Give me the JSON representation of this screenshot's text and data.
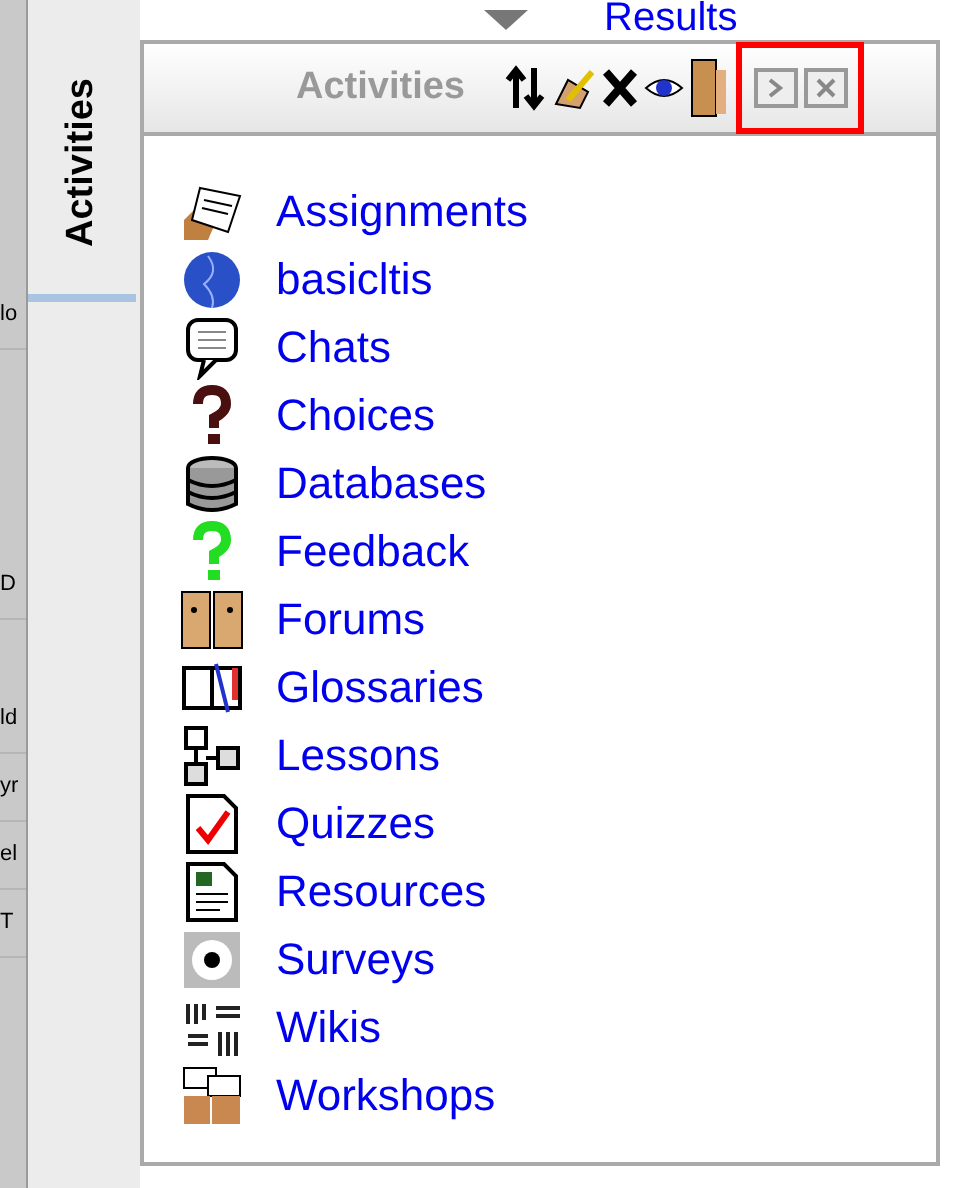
{
  "left_column_fragments": [
    "lo",
    "D",
    "ld",
    "yr",
    "el",
    "T"
  ],
  "results_link": "Results",
  "side_tab": {
    "label": "Activities",
    "selected": true
  },
  "block": {
    "title": "Activities",
    "activities": [
      {
        "label": "Assignments"
      },
      {
        "label": "basicltis"
      },
      {
        "label": "Chats"
      },
      {
        "label": "Choices"
      },
      {
        "label": "Databases"
      },
      {
        "label": "Feedback"
      },
      {
        "label": "Forums"
      },
      {
        "label": "Glossaries"
      },
      {
        "label": "Lessons"
      },
      {
        "label": "Quizzes"
      },
      {
        "label": "Resources"
      },
      {
        "label": "Surveys"
      },
      {
        "label": "Wikis"
      },
      {
        "label": "Workshops"
      }
    ]
  }
}
